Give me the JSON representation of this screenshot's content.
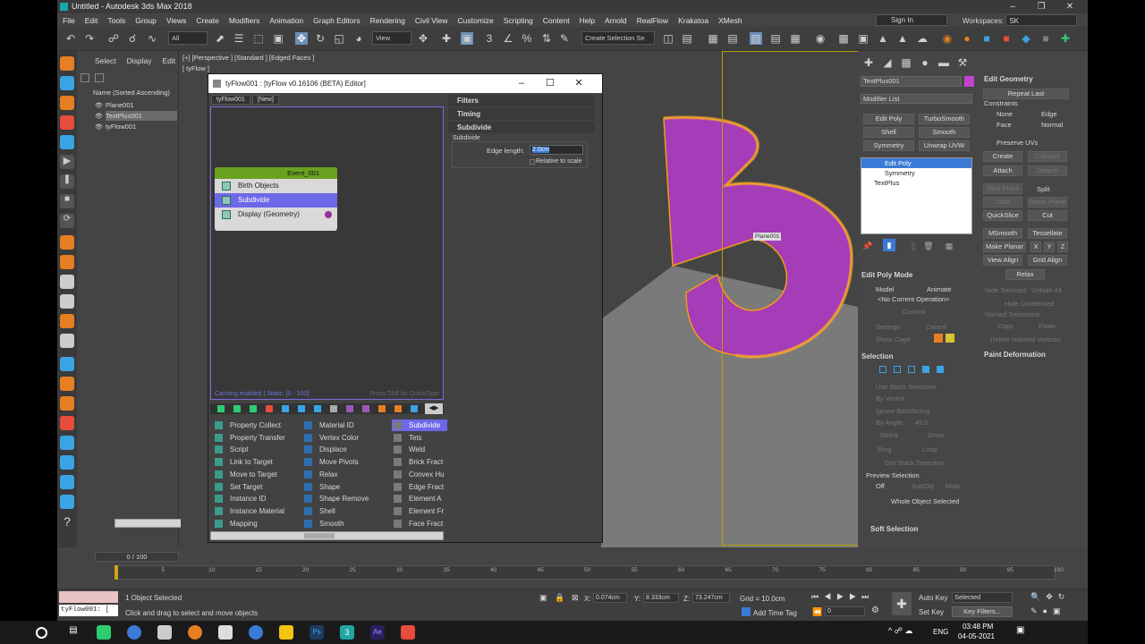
{
  "window": {
    "title": "Untitled - Autodesk 3ds Max 2018"
  },
  "menu": [
    "File",
    "Edit",
    "Tools",
    "Group",
    "Views",
    "Create",
    "Modifiers",
    "Animation",
    "Graph Editors",
    "Rendering",
    "Civil View",
    "Customize",
    "Scripting",
    "Content",
    "Help",
    "Arnold",
    "RealFlow",
    "Krakatoa",
    "XMesh"
  ],
  "header": {
    "signin": "Sign In",
    "workspaces_label": "Workspaces:",
    "workspace_value": "SK"
  },
  "toolbar": {
    "filter_all": "All",
    "view_dropdown": "View",
    "selection_set": "Create Selection Se"
  },
  "scene_explorer": {
    "tabs": [
      "Select",
      "Display",
      "Edit"
    ],
    "column_header": "Name (Sorted Ascending)",
    "items": [
      "Plane001",
      "TextPlus001",
      "tyFlow001"
    ]
  },
  "viewport": {
    "label": "[+] [Perspective ] [Standard ] [Edged Faces ]",
    "sublabel": "[ tyFlow ]",
    "object_tag": "Plane001"
  },
  "tyflow": {
    "title": "tyFlow001 : [tyFlow v0.16106 (BETA) Editor]",
    "tabs": [
      "tyFlow001",
      "[New]"
    ],
    "event_name": "Event_001",
    "operators": [
      "Birth Objects",
      "Subdivide",
      "Display (Geometry)"
    ],
    "caching": "Caching enabled | Static: [0 - 100]",
    "press_tab": "Press TAB for QuickType",
    "rollouts": {
      "filters": "Filters",
      "timing": "Timing",
      "subdivide": "Subdivide"
    },
    "subdivide_group": "Subdivide",
    "edge_length_label": "Edge length:",
    "edge_length_value": "2.0cm",
    "relative_to_scale": "Relative to scale",
    "ops_col1": [
      "Property Collect",
      "Property Transfer",
      "Script",
      "Link to Target",
      "Move to Target",
      "Set Target",
      "Instance ID",
      "Instance Material",
      "Mapping"
    ],
    "ops_col2": [
      "Material ID",
      "Vertex Color",
      "Displace",
      "Move Pivots",
      "Relax",
      "Shape",
      "Shape Remove",
      "Shell",
      "Smooth"
    ],
    "ops_col3": [
      "Subdivide",
      "Tets",
      "Weld",
      "Brick Fract",
      "Convex Hu",
      "Edge Fract",
      "Element A",
      "Element Fr",
      "Face Fract"
    ]
  },
  "command_panel": {
    "object_name": "TextPlus001",
    "modifier_list": "Modifier List",
    "buttons": [
      "Edit Poly",
      "TurboSmooth",
      "Shell",
      "Smooth",
      "Symmetry",
      "Unwrap UVW"
    ],
    "stack": [
      "Edit Poly",
      "Symmetry",
      "TextPlus"
    ],
    "edit_poly_mode": "Edit Poly Mode",
    "model": "Model",
    "animate": "Animate",
    "no_op": "<No Current Operation>",
    "commit": "Commit",
    "settings": "Settings",
    "cancel": "Cancel",
    "show_cage": "Show Cage",
    "selection": "Selection",
    "use_stack": "Use Stack Selection",
    "by_vertex": "By Vertex",
    "ignore_backfacing": "Ignore Backfacing",
    "by_angle": "By Angle:",
    "by_angle_val": "45.0",
    "shrink": "Shrink",
    "grow": "Grow",
    "ring": "Ring",
    "loop": "Loop",
    "get_stack": "Get Stack Selection",
    "preview_selection": "Preview Selection",
    "off": "Off",
    "subobj": "SubObj",
    "multi": "Multi",
    "whole_object": "Whole Object Selected",
    "soft_selection": "Soft Selection",
    "edit_geometry": "Edit Geometry",
    "repeat_last": "Repeat Last",
    "constraints": "Constraints",
    "none": "None",
    "edge": "Edge",
    "face": "Face",
    "normal": "Normal",
    "preserve_uvs": "Preserve UVs",
    "create": "Create",
    "collapse": "Collapse",
    "attach": "Attach",
    "detach": "Detach",
    "slice_plane": "Slice Plane",
    "split": "Split",
    "slice": "Slice",
    "reset_plane": "Reset Plane",
    "quickslice": "QuickSlice",
    "cut": "Cut",
    "msmooth": "MSmooth",
    "tessellate": "Tessellate",
    "make_planar": "Make Planar",
    "x": "X",
    "y": "Y",
    "z": "Z",
    "view_align": "View Align",
    "grid_align": "Grid Align",
    "relax": "Relax",
    "hide_selected": "Hide Selected",
    "unhide_all": "Unhide All",
    "hide_unselected": "Hide Unselected",
    "named_selections": "Named Selections:",
    "copy": "Copy",
    "paste": "Paste",
    "delete_isolated": "Delete Isolated Vertices",
    "paint_deformation": "Paint Deformation"
  },
  "timeline": {
    "frame": "0 / 100",
    "ticks": [
      "0",
      "5",
      "10",
      "15",
      "20",
      "25",
      "30",
      "35",
      "40",
      "45",
      "50",
      "55",
      "60",
      "65",
      "70",
      "75",
      "80",
      "85",
      "90",
      "95",
      "100"
    ]
  },
  "status": {
    "maxscript": "tyFlow001: [",
    "objects_selected": "1 Object Selected",
    "prompt": "Click and drag to select and move objects",
    "x_label": "X:",
    "x_val": "0.074cm",
    "y_label": "Y:",
    "y_val": "8.333cm",
    "z_label": "Z:",
    "z_val": "73.247cm",
    "grid": "Grid = 10.0cm",
    "add_time_tag": "Add Time Tag",
    "auto_key": "Auto Key",
    "selected": "Selected",
    "set_key": "Set Key",
    "key_filters": "Key Filters...",
    "frame_val": "0"
  },
  "taskbar": {
    "lang": "ENG",
    "time": "03:48 PM",
    "date": "04-05-2021"
  }
}
